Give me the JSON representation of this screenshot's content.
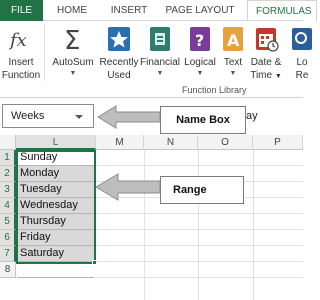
{
  "tabs": {
    "file": "FILE",
    "home": "HOME",
    "insert": "INSERT",
    "page_layout": "PAGE LAYOUT",
    "formulas": "FORMULAS"
  },
  "ribbon": {
    "insert_function": {
      "icon_glyph": "fx",
      "line1": "Insert",
      "line2": "Function"
    },
    "autosum": {
      "icon_glyph": "Σ",
      "line1": "AutoSum",
      "line2": ""
    },
    "recently_used": {
      "line1": "Recently",
      "line2": "Used"
    },
    "financial": {
      "line1": "Financial",
      "line2": ""
    },
    "logical": {
      "icon_glyph": "?",
      "line1": "Logical",
      "line2": ""
    },
    "text": {
      "icon_glyph": "A",
      "line1": "Text",
      "line2": ""
    },
    "date_time": {
      "line1": "Date &",
      "line2": "Time"
    },
    "lookup": {
      "line1": "Lo",
      "line2": "Re"
    },
    "group_label": "Function Library"
  },
  "formula_bar": {
    "name_box_value": "Weeks",
    "formula_text": "ay"
  },
  "callouts": {
    "name_box": "Name Box",
    "range": "Range"
  },
  "grid": {
    "columns": [
      "L",
      "M",
      "N",
      "O",
      "P"
    ],
    "rows": [
      "1",
      "2",
      "3",
      "4",
      "5",
      "6",
      "7",
      "8"
    ],
    "column_L_values": [
      "Sunday",
      "Monday",
      "Tuesday",
      "Wednesday",
      "Thursday",
      "Friday",
      "Saturday"
    ]
  },
  "colors": {
    "excel_green": "#217346",
    "selection_fill": "#d9d9d9",
    "autosum_blue": "#2c5d9c",
    "recent_star_blue": "#2a6fb0",
    "financial_teal": "#2e7d6e",
    "logical_purple": "#7b3b9c",
    "text_orange": "#e6a23c",
    "date_red": "#c0392b"
  },
  "icons": [
    "fx-icon",
    "autosum-sigma-icon",
    "star-book-icon",
    "financial-book-icon",
    "logical-question-icon",
    "text-a-icon",
    "calendar-clock-icon",
    "lookup-icon"
  ]
}
